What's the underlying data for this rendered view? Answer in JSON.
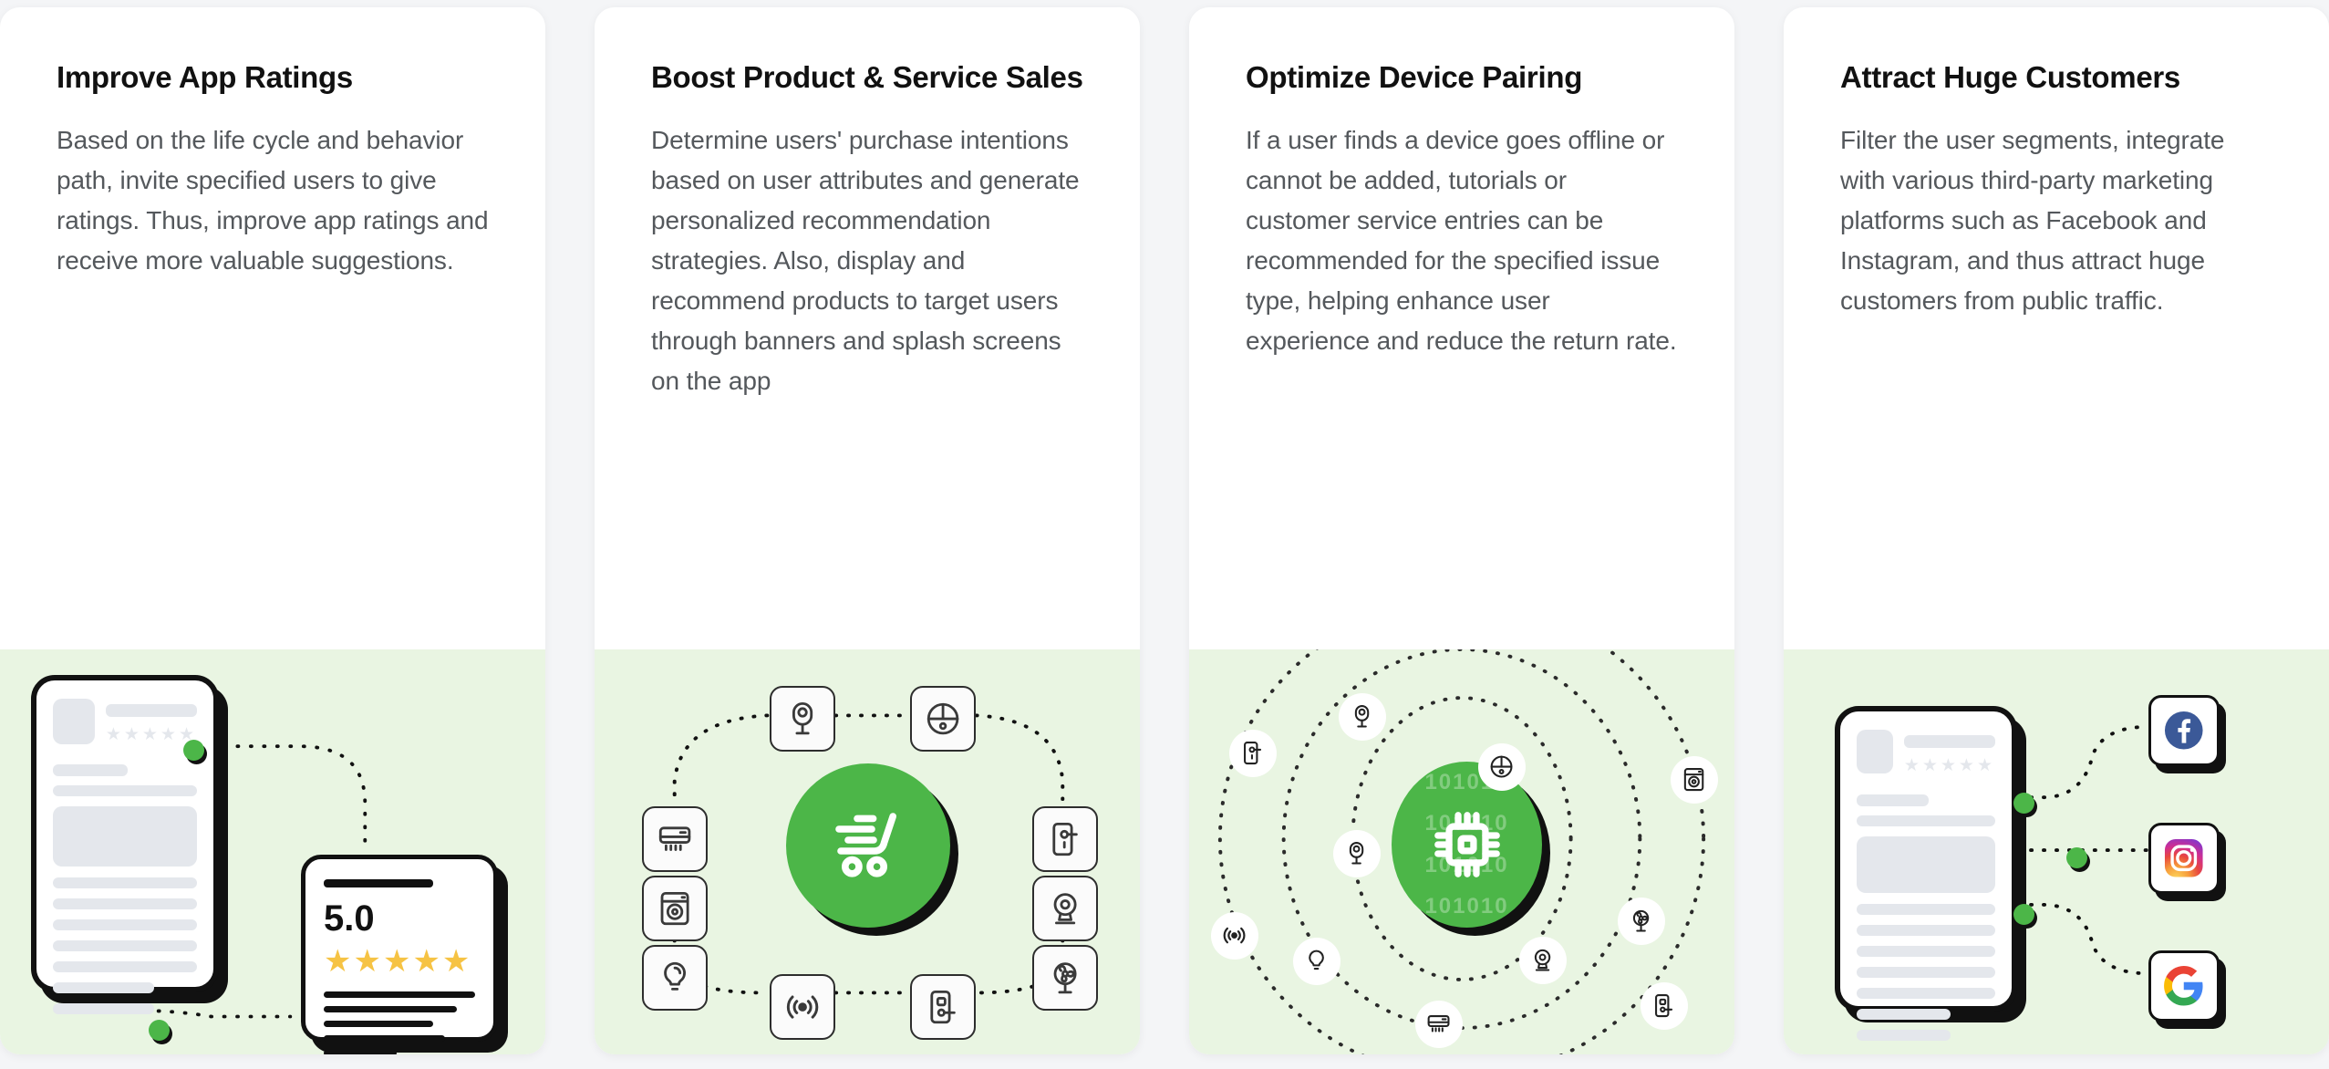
{
  "theme": {
    "page_bg": "#f4f5f7",
    "card_bg": "#ffffff",
    "illustration_bg": "#e9f5e2",
    "accent_green": "#4cb648",
    "title_color": "#111111",
    "body_color": "#54585c",
    "star_color": "#f6c344",
    "facebook_blue": "#3b5998",
    "google_blue": "#4285f4",
    "google_red": "#ea4335",
    "google_yellow": "#fbbc05",
    "google_green": "#34a853"
  },
  "cards": [
    {
      "id": "improve-app-ratings",
      "title": "Improve App Ratings",
      "description": "Based on the life cycle and behavior path, invite specified users to give ratings. Thus, improve app ratings and receive more valuable suggestions.",
      "illustration": {
        "type": "phone-rating",
        "rating_value": "5.0",
        "stars_filled": 5,
        "stars_total": 5,
        "star_glyph": "★"
      }
    },
    {
      "id": "boost-product-service-sales",
      "title": "Boost Product & Service Sales",
      "description": "Determine users' purchase intentions based on user attributes and generate personalized recommendation strategies. Also, display and recommend products to target users through banners and splash screens on the app",
      "illustration": {
        "type": "hub-ring",
        "hub_icon": "shopping-cart-icon",
        "device_icons": [
          "security-camera-icon",
          "smart-speaker-icon",
          "air-conditioner-icon",
          "smart-door-lock-icon",
          "washing-machine-icon",
          "webcam-icon",
          "light-bulb-icon",
          "smart-fan-icon",
          "wifi-signal-icon",
          "door-sensor-icon"
        ]
      }
    },
    {
      "id": "optimize-device-pairing",
      "title": "Optimize Device Pairing",
      "description": "If a user finds a device goes offline or cannot be added, tutorials or customer service entries can be recommended for the specified issue type, helping enhance user experience and reduce the return rate.",
      "illustration": {
        "type": "orbit",
        "hub_icon": "microchip-icon",
        "binary_text": [
          "101010",
          "101010",
          "101010",
          "101010"
        ],
        "device_icons": [
          "security-camera-icon",
          "smart-speaker-icon",
          "smart-door-lock-icon",
          "washing-machine-icon",
          "security-camera-icon",
          "webcam-icon",
          "smart-fan-icon",
          "wifi-signal-icon",
          "light-bulb-icon",
          "air-conditioner-icon",
          "door-sensor-icon"
        ]
      }
    },
    {
      "id": "attract-huge-customers",
      "title": "Attract Huge Customers",
      "description": "Filter the user segments, integrate with various third-party marketing platforms such as Facebook and Instagram, and thus attract huge customers from public traffic.",
      "illustration": {
        "type": "phone-social",
        "platforms": [
          "facebook-icon",
          "instagram-icon",
          "google-icon"
        ],
        "stars_total": 5,
        "star_glyph": "★"
      }
    }
  ]
}
